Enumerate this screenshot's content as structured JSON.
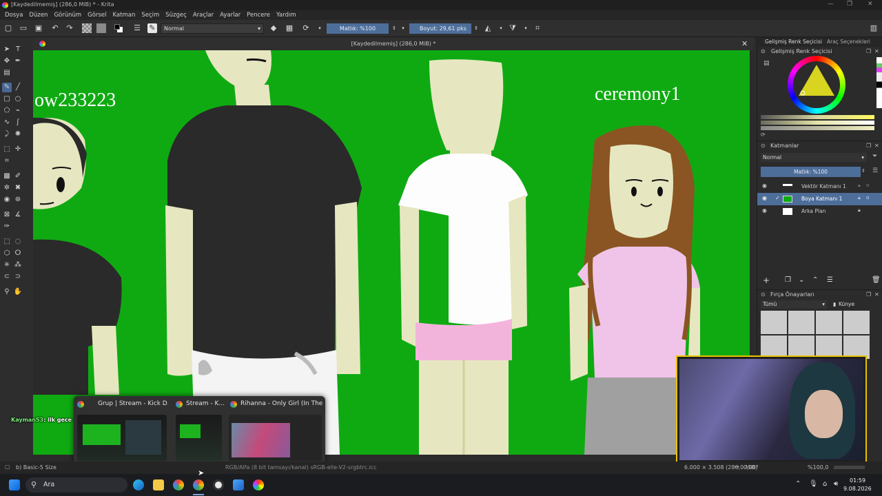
{
  "window": {
    "title": "[Kaydedilmemiş]  (286,0 MiB) * - Krita"
  },
  "menu": [
    "Dosya",
    "Düzen",
    "Görünüm",
    "Görsel",
    "Katman",
    "Seçim",
    "Süzgeç",
    "Araçlar",
    "Ayarlar",
    "Pencere",
    "Yardım"
  ],
  "toolbar": {
    "blend_mode": "Normal",
    "opacity_label": "Matlık: %100",
    "size_label": "Boyut: 29,61 pks"
  },
  "document": {
    "tab_title": "[Kaydedilmemiş]  (286,0 MiB) *"
  },
  "canvas_text": {
    "left_name": "ow233223",
    "right_name": "ceremony1"
  },
  "docker": {
    "tabs": [
      "Gelişmiş Renk Seçicisi",
      "Araç Seçenekleri"
    ],
    "color_panel_title": "Gelişmiş Renk Seçicisi",
    "layers_title": "Katmanlar",
    "layer_blend": "Normal",
    "layer_opacity": "Matlık: %100",
    "layers": [
      {
        "name": "Vektör Katmanı 1",
        "selected": false
      },
      {
        "name": "Boya Katmanı 1",
        "selected": true
      },
      {
        "name": "Arka Plan",
        "selected": false
      }
    ],
    "brush_presets_title": "Fırça Önayarları",
    "brush_filter": "Tümü",
    "brush_tag": "Künye"
  },
  "status": {
    "brush": "b) Basic-5 Size",
    "color_profile": "RGB/Alfa (8 bit tamsayı/kanal)  sRGB-elle-V2-srgbtrc.icc",
    "dimensions": "6.000 × 3.508 (286,0 MiB)",
    "rotation": "0,00°",
    "zoom": "%100,0"
  },
  "taskbar": {
    "search": "Ara",
    "time": "01:59",
    "date": "9.08.2026"
  },
  "preview": {
    "windows": [
      "Grup | Stream - Kick D...",
      "Stream - K...",
      "Rihanna - Only Girl (In The..."
    ]
  },
  "chat": {
    "user": "Kayman53",
    "message": ": ilk gece yayını galiba"
  },
  "colors": {
    "canvas_green": "#0faa12",
    "selection_blue": "#4e6e9a",
    "webcam_border": "#e8c300"
  }
}
